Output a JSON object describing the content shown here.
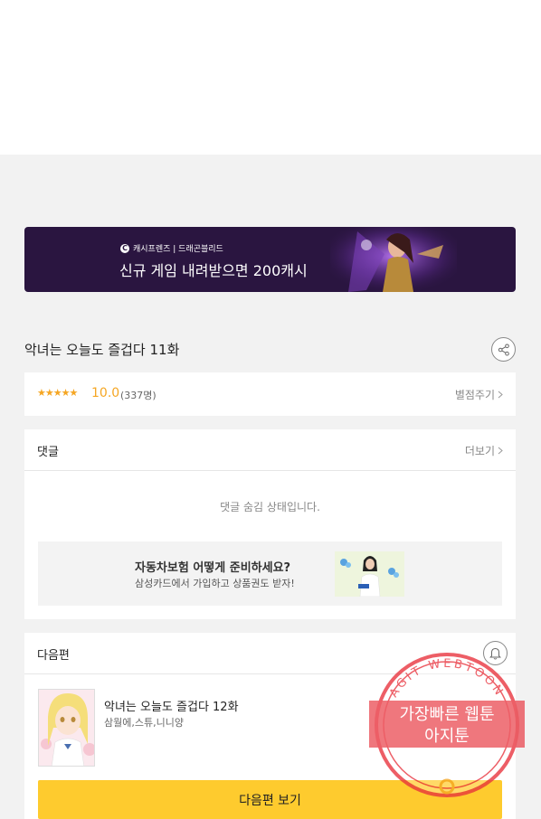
{
  "banner": {
    "brand": "캐시프렌즈 | 드래곤블리드",
    "headline": "신규 게임 내려받으면 200캐시"
  },
  "episode": {
    "title": "악녀는 오늘도 즐겁다 11화"
  },
  "rating": {
    "stars": "★★★★★",
    "score": "10.0",
    "count": "(337명)",
    "action": "별점주기"
  },
  "comments": {
    "label": "댓글",
    "more": "더보기",
    "hidden_message": "댓글 숨김 상태입니다."
  },
  "ad": {
    "title": "자동차보험 어떻게 준비하세요?",
    "subtitle": "삼성카드에서 가입하고 상품권도 받자!"
  },
  "next": {
    "label": "다음편",
    "title": "악녀는 오늘도 즐겁다 12화",
    "author": "삼월에,스튜,니니양",
    "button": "다음편 보기"
  },
  "watermark": {
    "arc_text": "AGIT WEBTOON",
    "line1": "가장빠른 웹툰",
    "line2": "아지툰"
  },
  "colors": {
    "accent_yellow": "#fecb2e",
    "star_orange": "#f5a623",
    "banner_bg": "#2a1540",
    "stamp_red": "#e8323c"
  }
}
